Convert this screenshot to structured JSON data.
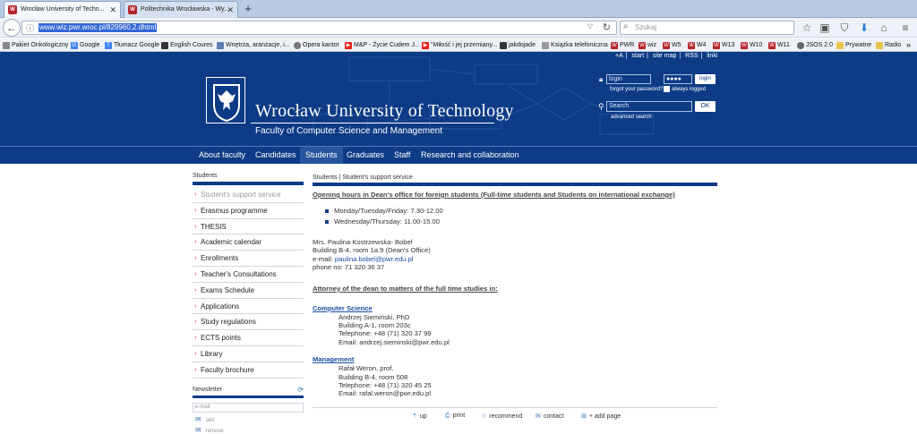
{
  "browser": {
    "tabs": [
      {
        "title": "Wrocław University of Techn..."
      },
      {
        "title": "Politechnika Wrocławska - Wy..."
      }
    ],
    "url": "www.wiz.pwr.wroc.pl/829960,2.dhtml",
    "search_placeholder": "Szukaj",
    "bookmarks": [
      {
        "label": "Pakiet Onkologiczny",
        "icon": "document-icon"
      },
      {
        "label": "Google",
        "icon": "google-icon"
      },
      {
        "label": "Tłumacz Google",
        "icon": "translate-icon"
      },
      {
        "label": "English Coures",
        "icon": "bookmark-icon"
      },
      {
        "label": "Wnętrza, aranżacje, i...",
        "icon": "image-icon"
      },
      {
        "label": "Opera kantor",
        "icon": "globe-icon"
      },
      {
        "label": "M&P - Życie Cudem J...",
        "icon": "youtube-icon"
      },
      {
        "label": "\"Miłość i jej przemiany...",
        "icon": "youtube-icon"
      },
      {
        "label": "jakdojade",
        "icon": "map-icon"
      },
      {
        "label": "Książka telefoniczna",
        "icon": "phone-icon"
      },
      {
        "label": "PWR",
        "icon": "pwr-icon"
      },
      {
        "label": "wiz",
        "icon": "pwr-icon"
      },
      {
        "label": "W5",
        "icon": "pwr-icon"
      },
      {
        "label": "W4",
        "icon": "pwr-icon"
      },
      {
        "label": "W13",
        "icon": "pwr-icon"
      },
      {
        "label": "W10",
        "icon": "pwr-icon"
      },
      {
        "label": "W11",
        "icon": "pwr-icon"
      },
      {
        "label": "JSOS 2.0",
        "icon": "gear-icon"
      },
      {
        "label": "Prywatne",
        "icon": "folder-icon"
      },
      {
        "label": "Radio",
        "icon": "folder-icon"
      }
    ],
    "overflow": "»"
  },
  "site": {
    "top_links": [
      "+A",
      "start",
      "site map",
      "RSS",
      "linki"
    ],
    "university_name": "Wrocław University of Technology",
    "faculty_name": "Faculty of Computer Science and Management",
    "login": {
      "login_value": "login",
      "password_value": "●●●●",
      "login_button": "login",
      "forgot": "forgot your password?",
      "remember": "always logged"
    },
    "search": {
      "value": "Search",
      "ok_button": "OK",
      "advanced": "advanced search"
    },
    "nav": [
      "About faculty",
      "Candidates",
      "Students",
      "Graduates",
      "Staff",
      "Research and collaboration"
    ],
    "nav_active": "Students"
  },
  "sidebar": {
    "title": "Students",
    "items": [
      "Student's support service",
      "Erasmus programme",
      "THESIS",
      "Academic calendar",
      "Enrollments",
      "Teacher's Consultations",
      "Exams Schedule",
      "Applications",
      "Study regulations",
      "ECTS points",
      "Library",
      "Faculty brochure"
    ]
  },
  "newsletter": {
    "title": "Newsletter",
    "email_placeholder": "e-mail",
    "add": "add",
    "remove": "remove"
  },
  "content": {
    "breadcrumb": "Students | Student's support service",
    "hours_heading": "Opening hours in Dean's office for foreign students (Full-time students and Students on international exchange)",
    "hours": [
      "Monday/Tuesday/Friday: 7.30-12.00",
      "Wednesday/Thursday: 11.00-15.00"
    ],
    "contact_name": "Mrs. Paulina Kostrzewska- Bobel",
    "contact_building": "Building B-4, room 1a.9 (Dean's Office)",
    "contact_email_label": "e-mail: ",
    "contact_email": "paulina.bobel@pwr.edu.pl",
    "contact_phone": "phone no: 71 320 36 37",
    "attorney_heading": "Attorney of the dean to matters of the full time studies in:",
    "cs": {
      "heading": "Computer Science",
      "name": "Andrzej Siemiński, PhD",
      "room": "Building A-1, room 203c",
      "phone": "Telephone: +48 (71) 320 37 99",
      "email": "Email: andrzej.sieminski@pwr.edu.pl"
    },
    "mgmt": {
      "heading": "Management",
      "name": "Rafał Weron, prof.",
      "room": "Building B-4, room 508",
      "phone": "Telephone: +48 (71) 320 45 25",
      "email": "Email: rafal.weron@pwr.edu.pl"
    },
    "actions": [
      "up",
      "print",
      "recommend",
      "contact",
      "+ add page"
    ]
  },
  "colors": {
    "brand_blue": "#0d3b86",
    "tab_blue": "#b9cbe3",
    "accent_red": "#c0392b"
  }
}
